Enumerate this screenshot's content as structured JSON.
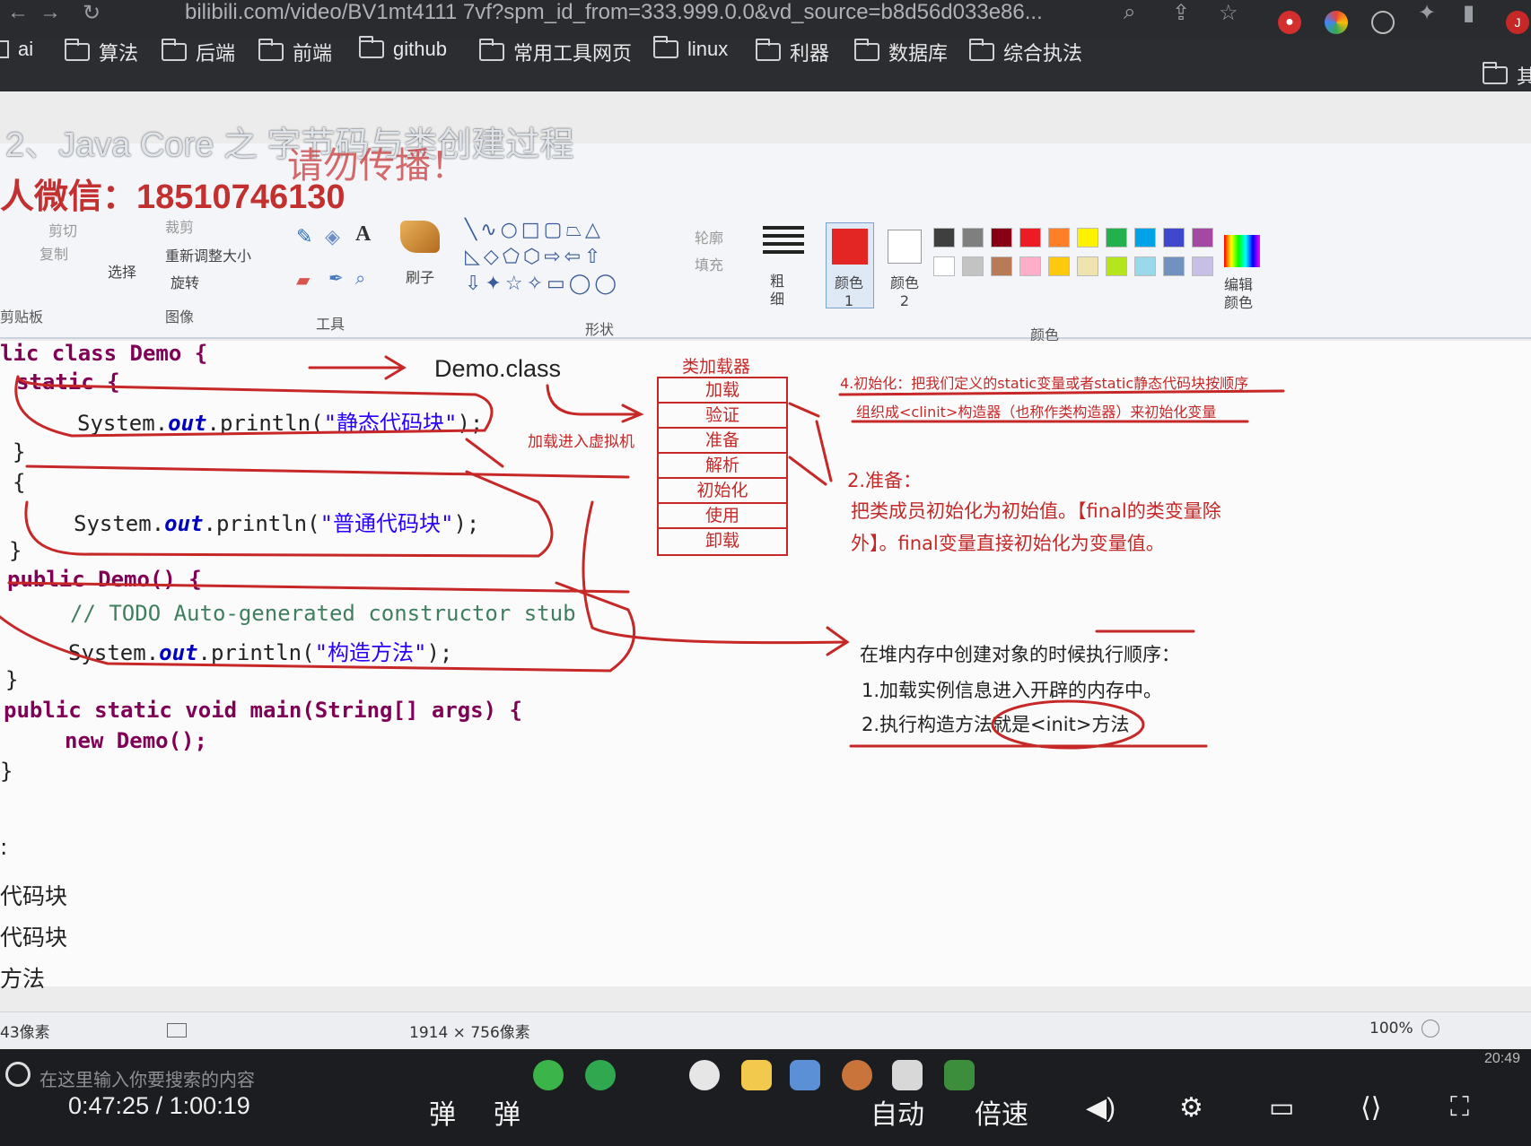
{
  "browser": {
    "url": "bilibili.com/video/BV1mt4111 7vf?spm_id_from=333.999.0.0&vd_source=b8d56d033e86...",
    "bookmarks": [
      "ai",
      "算法",
      "后端",
      "前端",
      "github",
      "常用工具网页",
      "linux",
      "利器",
      "数据库",
      "综合执法",
      "其"
    ]
  },
  "video": {
    "title": "2、Java Core 之 字节码与类创建过程",
    "watermark_1": "请勿传播！",
    "watermark_2_prefix": "人微信：",
    "watermark_2_number": "18510746130"
  },
  "paint": {
    "ribbon_groups": [
      "剪贴板",
      "图像",
      "工具",
      "形状",
      "颜色"
    ],
    "image_buttons": [
      "选择",
      "裁剪",
      "重新调整大小",
      "旋转"
    ],
    "clipboard_buttons": [
      "剪切",
      "复制"
    ],
    "brush_label": "刷子",
    "outline_label": "轮廓",
    "fill_label": "填充",
    "size_label": "粗细",
    "color1_label": "颜色 1",
    "color2_label": "颜色 2",
    "edit_colors_label": "编辑颜色",
    "palette": [
      "#3f3f3f",
      "#7f7f7f",
      "#880015",
      "#ed1c24",
      "#ff7f27",
      "#fff200",
      "#22b14c",
      "#00a2e8",
      "#3f48cc",
      "#a349a4",
      "#ffffff",
      "#c3c3c3",
      "#b97a57",
      "#ffaec9",
      "#ffc90e",
      "#efe4b0",
      "#b5e61d",
      "#99d9ea",
      "#7092be",
      "#c8bfe7"
    ],
    "status_position": "43像素",
    "status_size": "1914 × 756像素",
    "status_zoom": "100%"
  },
  "code": {
    "line1": "lic class Demo {",
    "line2": "static {",
    "line3a": "System.",
    "line3b": "out",
    "line3c": ".println(",
    "line3d": "\"静态代码块\"",
    "line3e": ");",
    "line4": "}",
    "line5": "{",
    "line6a": "System.",
    "line6b": "out",
    "line6c": ".println(",
    "line6d": "\"普通代码块\"",
    "line6e": ");",
    "line7": "}",
    "line8": "public Demo() {",
    "line9": "// TODO Auto-generated constructor stub",
    "line10a": "System.",
    "line10b": "out",
    "line10c": ".println(",
    "line10d": "\"构造方法\"",
    "line10e": ");",
    "line11": "}",
    "line12": "public static void main(String[] args) {",
    "line13": "new Demo();",
    "line14": "}"
  },
  "annotations": {
    "demo_class": "Demo.class",
    "load_into_vm": "加载进入虚拟机",
    "loader_title": "类加载器",
    "loader_steps": [
      "加载",
      "验证",
      "准备",
      "解析",
      "初始化",
      "使用",
      "卸载"
    ],
    "init_line1": "4.初始化：把我们定义的static变量或者static静态代码块按顺序",
    "init_line2": "组织成<clinit>构造器（也称作类构造器）来初始化变量",
    "prepare_title": "2.准备：",
    "prepare_line1": "把类成员初始化为初始值。【final的类变量除",
    "prepare_line2": "外】。final变量直接初始化为变量值。",
    "heap_title": "在堆内存中创建对象的时候执行顺序：",
    "heap_step1": "1.加载实例信息进入开辟的内存中。",
    "heap_step2": "2.执行构造方法就是<init>方法"
  },
  "console_output": [
    ":",
    "代码块",
    "代码块",
    "方法"
  ],
  "player": {
    "search_placeholder": "在这里输入你要搜索的内容",
    "current_time": "0:47:25",
    "separator": "/",
    "total_time": "1:00:19",
    "danmaku_label": "弹",
    "auto_label": "自动",
    "speed_label": "倍速",
    "clock": "20:49"
  }
}
